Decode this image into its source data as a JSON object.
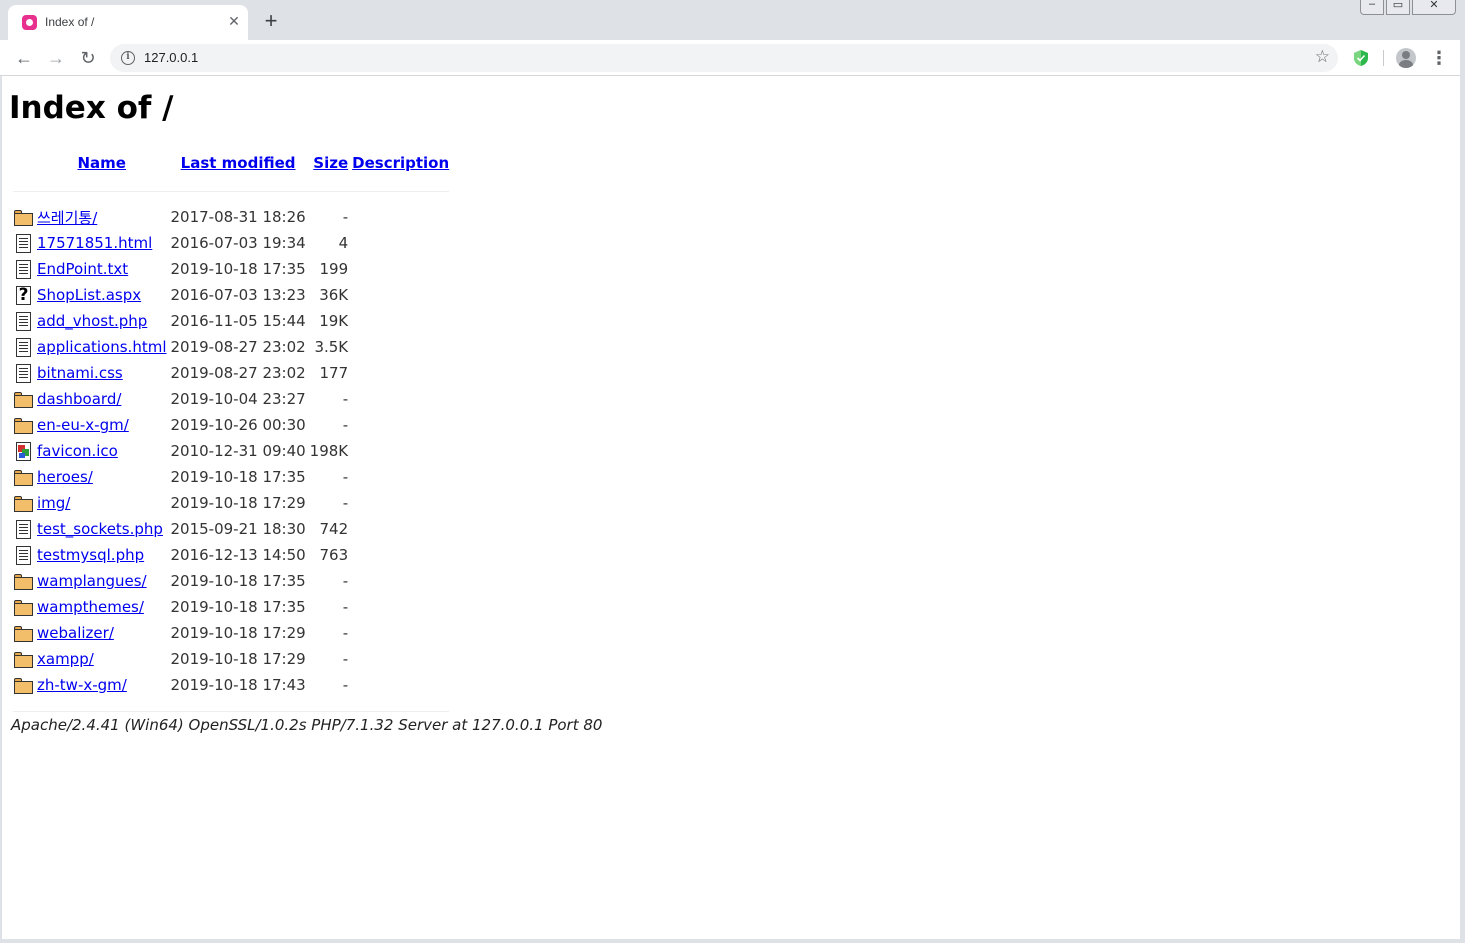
{
  "browser": {
    "tab_title": "Index of /",
    "tab_close": "✕",
    "new_tab": "+",
    "url": "127.0.0.1",
    "back": "←",
    "forward": "→",
    "reload": "↻",
    "star": "☆",
    "menu": "⋮",
    "window_min": "‒",
    "window_max": "▭",
    "window_close": "✕"
  },
  "page": {
    "title": "Index of /",
    "headers": {
      "name": "Name",
      "last_modified": "Last modified",
      "size": "Size",
      "description": "Description"
    },
    "entries": [
      {
        "icon": "folder",
        "name": "쓰레기통/",
        "modified": "2017-08-31 18:26",
        "size": "-"
      },
      {
        "icon": "doc",
        "name": "17571851.html",
        "modified": "2016-07-03 19:34",
        "size": "4"
      },
      {
        "icon": "doc",
        "name": "EndPoint.txt",
        "modified": "2019-10-18 17:35",
        "size": "199"
      },
      {
        "icon": "unknown",
        "name": "ShopList.aspx",
        "modified": "2016-07-03 13:23",
        "size": "36K"
      },
      {
        "icon": "doc",
        "name": "add_vhost.php",
        "modified": "2016-11-05 15:44",
        "size": "19K"
      },
      {
        "icon": "doc",
        "name": "applications.html",
        "modified": "2019-08-27 23:02",
        "size": "3.5K"
      },
      {
        "icon": "doc",
        "name": "bitnami.css",
        "modified": "2019-08-27 23:02",
        "size": "177"
      },
      {
        "icon": "folder",
        "name": "dashboard/",
        "modified": "2019-10-04 23:27",
        "size": "-"
      },
      {
        "icon": "folder",
        "name": "en-eu-x-gm/",
        "modified": "2019-10-26 00:30",
        "size": "-"
      },
      {
        "icon": "image",
        "name": "favicon.ico",
        "modified": "2010-12-31 09:40",
        "size": "198K"
      },
      {
        "icon": "folder",
        "name": "heroes/",
        "modified": "2019-10-18 17:35",
        "size": "-"
      },
      {
        "icon": "folder",
        "name": "img/",
        "modified": "2019-10-18 17:29",
        "size": "-"
      },
      {
        "icon": "doc",
        "name": "test_sockets.php",
        "modified": "2015-09-21 18:30",
        "size": "742"
      },
      {
        "icon": "doc",
        "name": "testmysql.php",
        "modified": "2016-12-13 14:50",
        "size": "763"
      },
      {
        "icon": "folder",
        "name": "wamplangues/",
        "modified": "2019-10-18 17:35",
        "size": "-"
      },
      {
        "icon": "folder",
        "name": "wampthemes/",
        "modified": "2019-10-18 17:35",
        "size": "-"
      },
      {
        "icon": "folder",
        "name": "webalizer/",
        "modified": "2019-10-18 17:29",
        "size": "-"
      },
      {
        "icon": "folder",
        "name": "xampp/",
        "modified": "2019-10-18 17:29",
        "size": "-"
      },
      {
        "icon": "folder",
        "name": "zh-tw-x-gm/",
        "modified": "2019-10-18 17:43",
        "size": "-"
      }
    ],
    "footer": "Apache/2.4.41 (Win64) OpenSSL/1.0.2s PHP/7.1.32 Server at 127.0.0.1 Port 80"
  },
  "colors": {
    "link": "#0000ee",
    "chrome_bg": "#dee1e6",
    "favicon": "#e8318f"
  }
}
